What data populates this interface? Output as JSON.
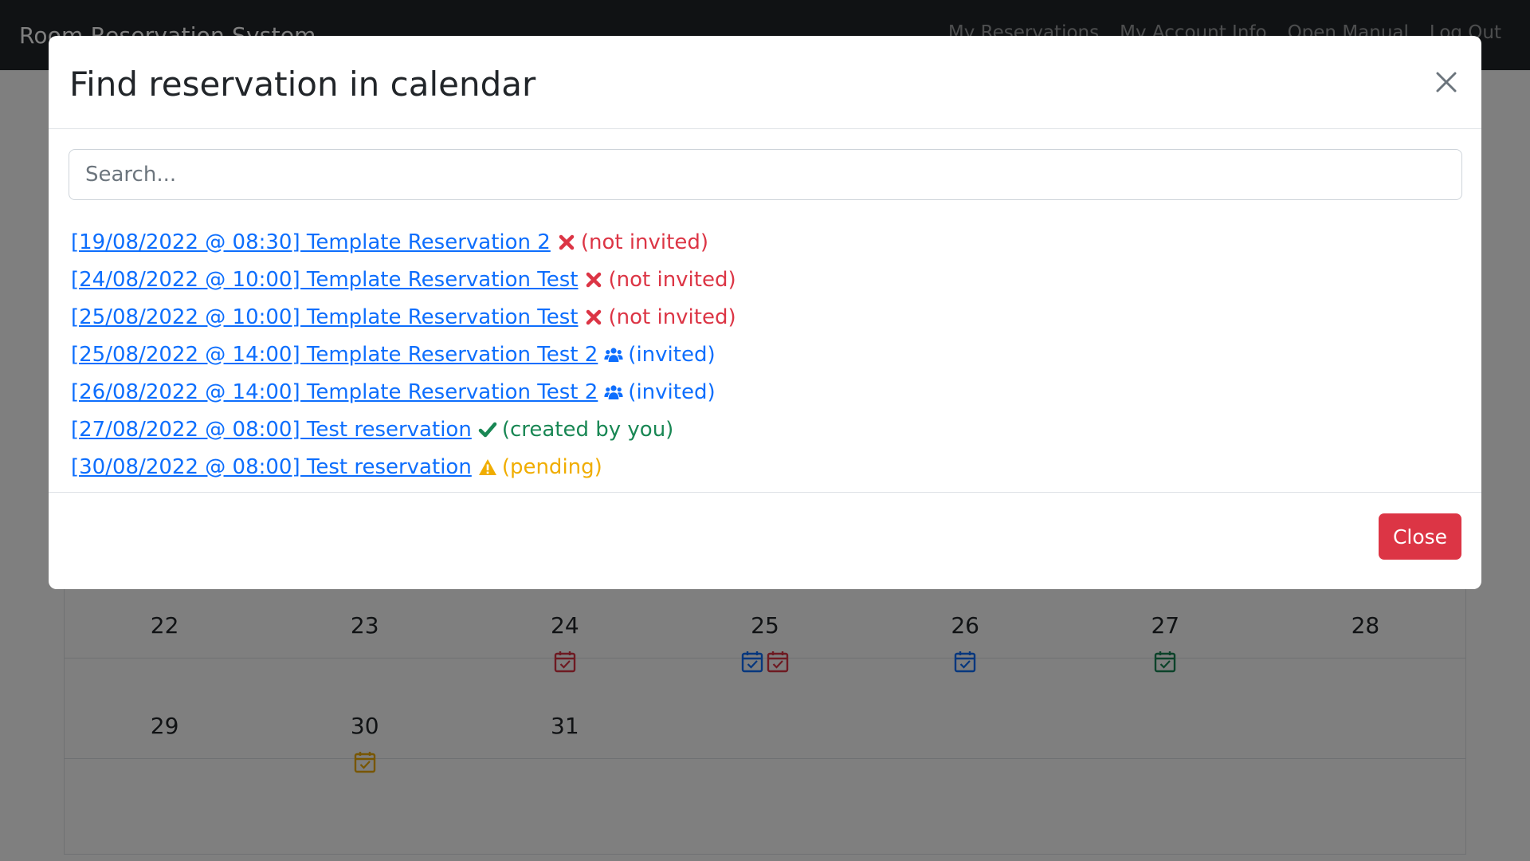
{
  "navbar": {
    "brand": "Room Reservation System",
    "links": [
      "My Reservations",
      "My Account Info",
      "Open Manual",
      "Log Out"
    ]
  },
  "calendar": {
    "weeks": [
      [
        {
          "day": "22",
          "icons": []
        },
        {
          "day": "23",
          "icons": []
        },
        {
          "day": "24",
          "icons": [
            "#dc3545"
          ]
        },
        {
          "day": "25",
          "icons": [
            "#0d6efd",
            "#dc3545"
          ]
        },
        {
          "day": "26",
          "icons": [
            "#0d6efd"
          ]
        },
        {
          "day": "27",
          "icons": [
            "#198754"
          ]
        },
        {
          "day": "28",
          "icons": []
        }
      ],
      [
        {
          "day": "29",
          "icons": []
        },
        {
          "day": "30",
          "icons": [
            "#f0ad00"
          ]
        },
        {
          "day": "31",
          "icons": []
        },
        {
          "day": "",
          "icons": []
        },
        {
          "day": "",
          "icons": []
        },
        {
          "day": "",
          "icons": []
        },
        {
          "day": "",
          "icons": []
        }
      ]
    ]
  },
  "modal": {
    "title": "Find reservation in calendar",
    "search_placeholder": "Search...",
    "close_label": "Close"
  },
  "reservations": [
    {
      "link": "[19/08/2022 @ 08:30] Template Reservation 2",
      "status_icon": "times-icon",
      "status": "(not invited)",
      "color": "#dc3545"
    },
    {
      "link": "[24/08/2022 @ 10:00] Template Reservation Test",
      "status_icon": "times-icon",
      "status": "(not invited)",
      "color": "#dc3545"
    },
    {
      "link": "[25/08/2022 @ 10:00] Template Reservation Test",
      "status_icon": "times-icon",
      "status": "(not invited)",
      "color": "#dc3545"
    },
    {
      "link": "[25/08/2022 @ 14:00] Template Reservation Test 2",
      "status_icon": "users-icon",
      "status": "(invited)",
      "color": "#0d6efd"
    },
    {
      "link": "[26/08/2022 @ 14:00] Template Reservation Test 2",
      "status_icon": "users-icon",
      "status": "(invited)",
      "color": "#0d6efd"
    },
    {
      "link": "[27/08/2022 @ 08:00] Test reservation",
      "status_icon": "check-icon",
      "status": "(created by you)",
      "color": "#198754"
    },
    {
      "link": "[30/08/2022 @ 08:00] Test reservation",
      "status_icon": "warning-icon",
      "status": "(pending)",
      "color": "#f0ad00"
    }
  ]
}
